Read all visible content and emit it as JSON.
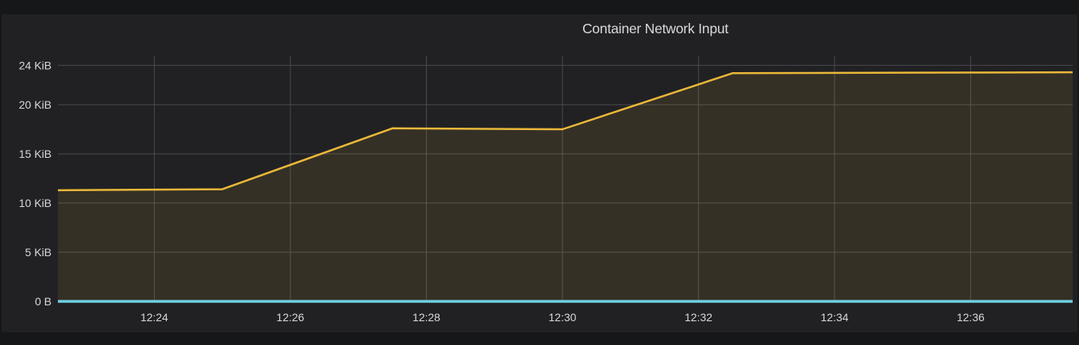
{
  "panel": {
    "title": "Container Network Input"
  },
  "chart_data": {
    "type": "area",
    "title": "Container Network Input",
    "xlabel": "",
    "ylabel": "",
    "x_ticks": [
      "12:24",
      "12:26",
      "12:28",
      "12:30",
      "12:32",
      "12:34",
      "12:36"
    ],
    "y_ticks": [
      "0 B",
      "5 KiB",
      "10 KiB",
      "15 KiB",
      "20 KiB",
      "24 KiB"
    ],
    "xlim": [
      "12:22:35",
      "12:37:30"
    ],
    "ylim": [
      0,
      25
    ],
    "y_unit": "KiB",
    "grid": true,
    "series": [
      {
        "color": "#eab839",
        "fill": true,
        "points": [
          {
            "t": "12:22:35",
            "y": 11.3
          },
          {
            "t": "12:25:00",
            "y": 11.4
          },
          {
            "t": "12:27:30",
            "y": 17.6
          },
          {
            "t": "12:30:00",
            "y": 17.5
          },
          {
            "t": "12:32:30",
            "y": 23.2
          },
          {
            "t": "12:37:30",
            "y": 23.3
          }
        ]
      },
      {
        "color": "#6ed0e0",
        "fill": false,
        "points": [
          {
            "t": "12:22:35",
            "y": 0
          },
          {
            "t": "12:37:30",
            "y": 0
          }
        ]
      }
    ]
  }
}
